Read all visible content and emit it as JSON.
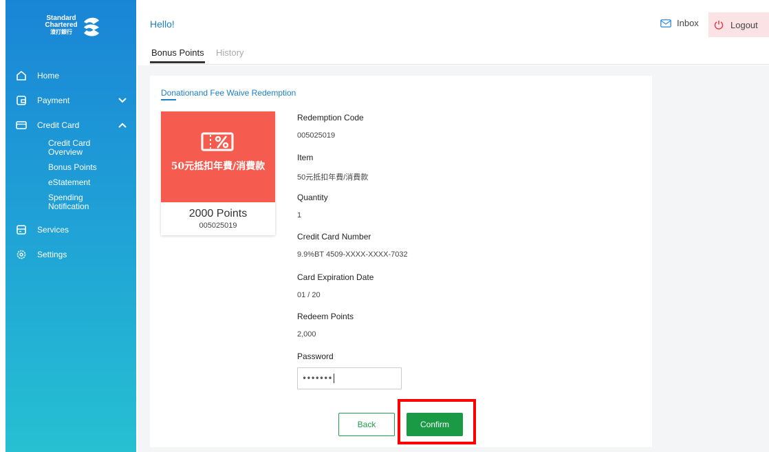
{
  "brand": {
    "logo_lines": [
      "Standard",
      "Chartered",
      "渣打銀行"
    ]
  },
  "sidebar": {
    "items": [
      {
        "label": "Home",
        "icon": "home-icon"
      },
      {
        "label": "Payment",
        "icon": "wallet-icon",
        "expanded": false
      },
      {
        "label": "Credit Card",
        "icon": "credit-card-icon",
        "expanded": true
      },
      {
        "label": "Services",
        "icon": "services-icon"
      },
      {
        "label": "Settings",
        "icon": "gear-icon"
      }
    ],
    "credit_card_sub": [
      {
        "label": "Credit Card Overview"
      },
      {
        "label": "Bonus Points"
      },
      {
        "label": "eStatement"
      },
      {
        "label": "Spending Notification"
      }
    ]
  },
  "header": {
    "greeting": "Hello!",
    "inbox_label": "Inbox",
    "logout_label": "Logout"
  },
  "tabs": [
    {
      "label": "Bonus Points",
      "active": true
    },
    {
      "label": "History",
      "active": false
    }
  ],
  "main": {
    "section_title": "Donationand Fee Waive Redemption",
    "voucher": {
      "name": "50元抵扣年費/消費款",
      "points": "2000 Points",
      "code": "005025019",
      "color": "#f55c4f"
    },
    "fields": [
      {
        "label": "Redemption Code",
        "value": "005025019"
      },
      {
        "label": "Item",
        "value": "50元抵扣年費/消費款"
      },
      {
        "label": "Quantity",
        "value": "1"
      },
      {
        "label": "Credit Card Number",
        "value": "9.9%BT 4509-XXXX-XXXX-7032"
      },
      {
        "label": "Card Expiration Date",
        "value": "01 / 20"
      },
      {
        "label": "Redeem Points",
        "value": "2,000"
      }
    ],
    "password": {
      "label": "Password",
      "value": "•••••••"
    },
    "back_label": "Back",
    "confirm_label": "Confirm"
  },
  "colors": {
    "sidebar_top": "#1a85d6",
    "sidebar_bottom": "#26c0d2",
    "accent_blue": "#1b7fc6",
    "confirm_green": "#1b9a45",
    "highlight_red": "#ff0000"
  }
}
